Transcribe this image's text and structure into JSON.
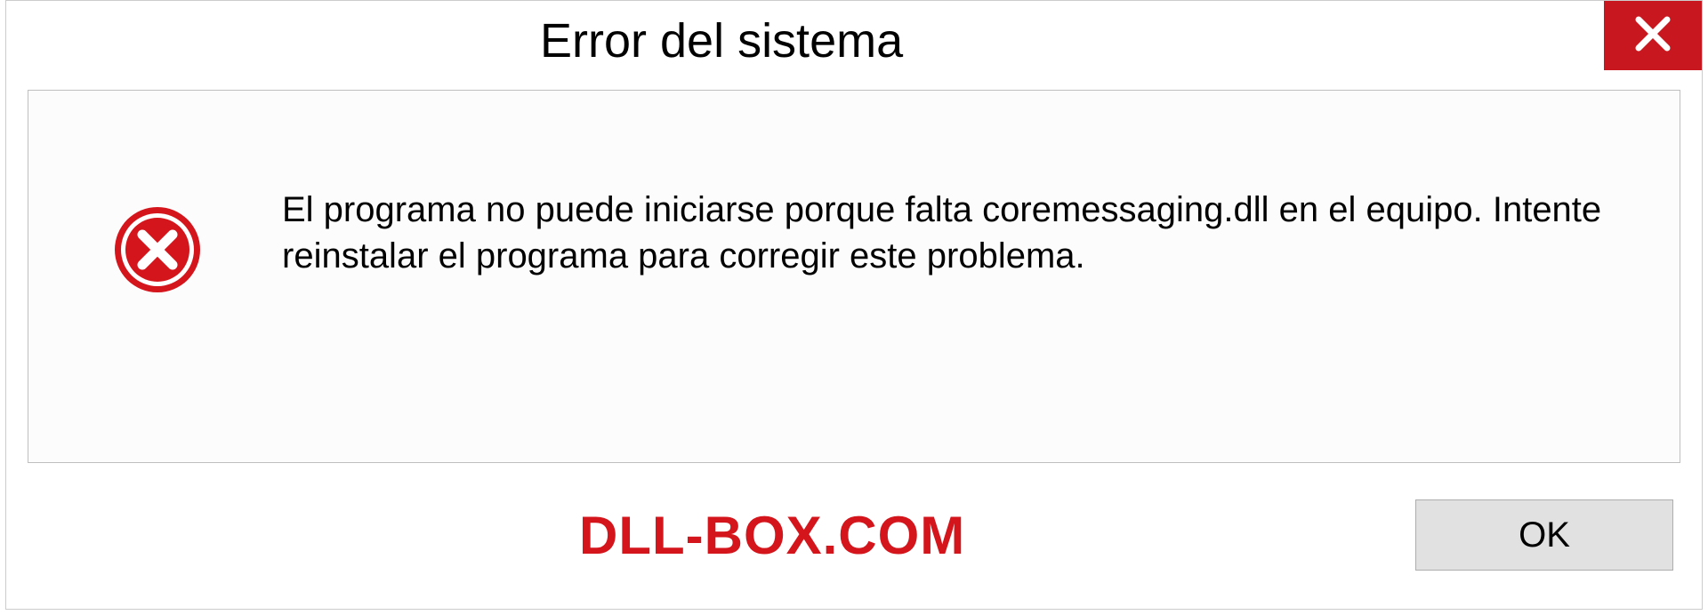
{
  "dialog": {
    "title": "Error del sistema",
    "message": "El programa no puede iniciarse porque falta coremessaging.dll en el equipo. Intente reinstalar el programa para corregir este problema.",
    "ok_label": "OK",
    "watermark": "DLL-BOX.COM"
  }
}
